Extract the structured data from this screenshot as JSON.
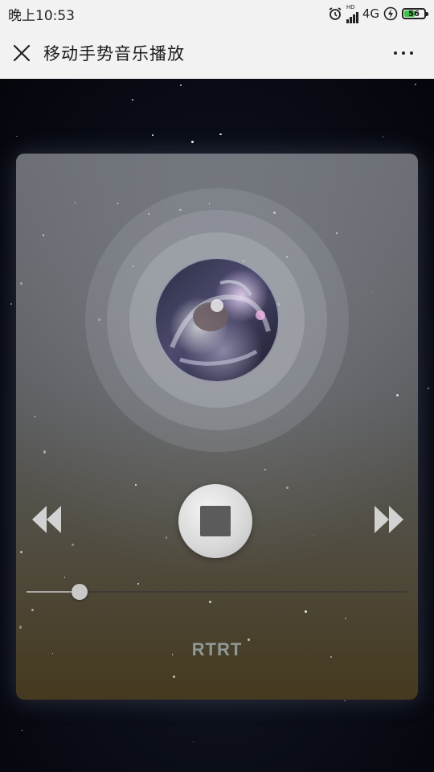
{
  "status_bar": {
    "time": "晚上10:53",
    "network": "4G",
    "hd_badge": "HD",
    "battery_level": "56",
    "icons": [
      "alarm-icon",
      "signal-icon",
      "charging-icon",
      "battery-icon"
    ]
  },
  "header": {
    "title": "移动手势音乐播放",
    "close_icon": "close-icon",
    "more_icon": "more-icon"
  },
  "player": {
    "song_title": "RTRT",
    "progress": 0.14,
    "state": "playing",
    "controls": [
      "rewind-icon",
      "stop-icon",
      "fast-forward-icon"
    ],
    "accent_color": "#41c24a"
  }
}
